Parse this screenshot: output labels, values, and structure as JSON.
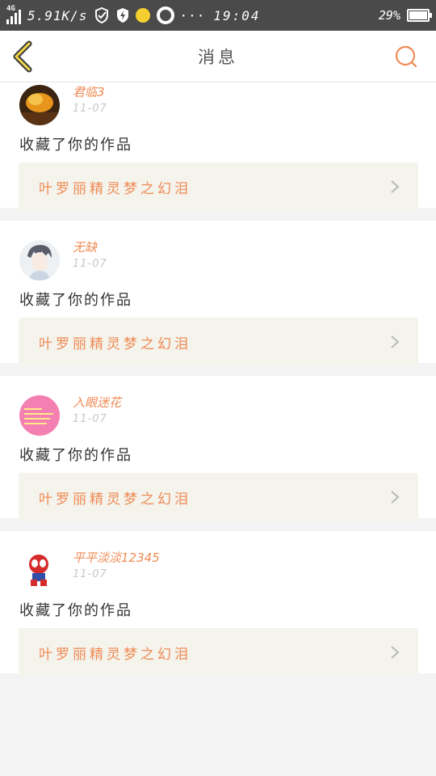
{
  "statusbar": {
    "network": "4G",
    "speed": "5.91K/s",
    "more": "···",
    "time": "19:04",
    "battery": "29%"
  },
  "header": {
    "title": "消息"
  },
  "messages": [
    {
      "username": "君临3",
      "time": "11-07",
      "action": "收藏了你的作品",
      "work": "叶罗丽精灵梦之幻泪",
      "avatar": "avatar-autumn"
    },
    {
      "username": "无缺",
      "time": "11-07",
      "action": "收藏了你的作品",
      "work": "叶罗丽精灵梦之幻泪",
      "avatar": "avatar-anime"
    },
    {
      "username": "入眼迷花",
      "time": "11-07",
      "action": "收藏了你的作品",
      "work": "叶罗丽精灵梦之幻泪",
      "avatar": "avatar-pink"
    },
    {
      "username": "平平淡淡12345",
      "time": "11-07",
      "action": "收藏了你的作品",
      "work": "叶罗丽精灵梦之幻泪",
      "avatar": "avatar-spider"
    }
  ],
  "colors": {
    "accent": "#f08b55",
    "statusbar": "#4a4a4a",
    "link_bg": "#f4f3ec"
  }
}
